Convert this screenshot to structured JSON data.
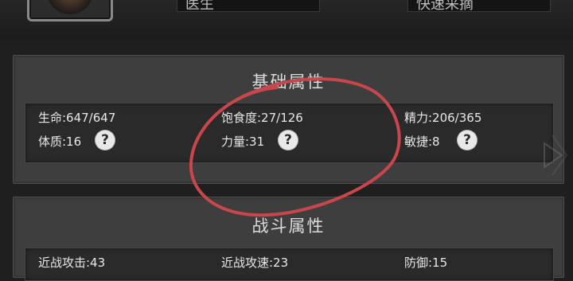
{
  "header": {
    "left_label": "",
    "left_value": "医生",
    "right_label": "",
    "right_value": "快速采摘"
  },
  "basic_attributes": {
    "title": "基础属性",
    "hp": "生命:647/647",
    "satiety": "饱食度:27/126",
    "energy": "精力:206/365",
    "constitution": "体质:16",
    "strength": "力量:31",
    "agility": "敏捷:8"
  },
  "combat_attributes": {
    "title": "战斗属性",
    "melee_attack": "近战攻击:43",
    "melee_speed": "近战攻速:23",
    "defense": "防御:15"
  },
  "help_icon": "?",
  "annotation_color": "#c8464c"
}
